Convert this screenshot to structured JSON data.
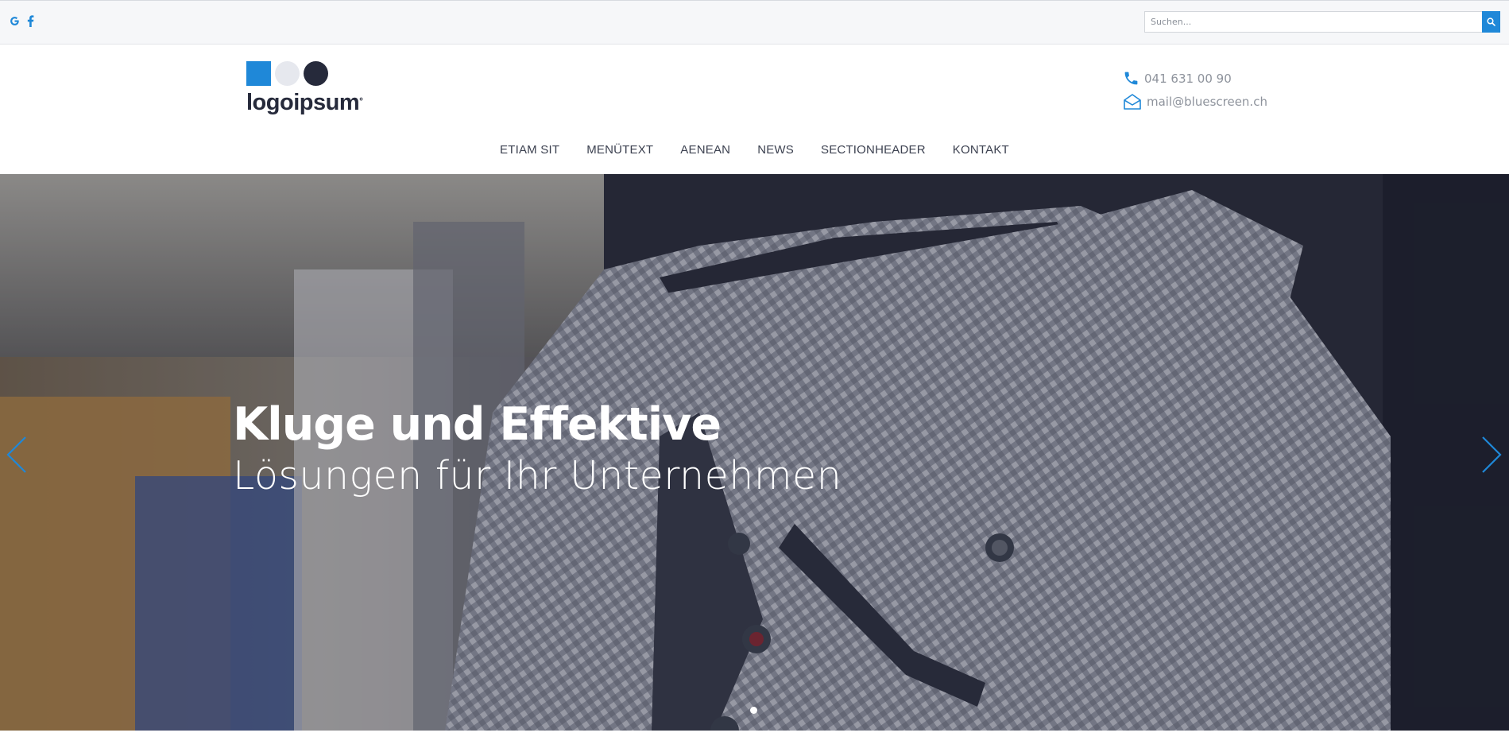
{
  "topbar": {
    "social": [
      {
        "name": "google-icon",
        "label": "Google"
      },
      {
        "name": "facebook-icon",
        "label": "Facebook"
      }
    ],
    "search": {
      "placeholder": "Suchen...",
      "value": ""
    }
  },
  "header": {
    "logo_text": "logoipsum",
    "logo_mark": "°",
    "phone": "041 631 00 90",
    "email": "mail@bluescreen.ch"
  },
  "nav": {
    "items": [
      "ETIAM SIT",
      "MENÜTEXT",
      "AENEAN",
      "NEWS",
      "SECTIONHEADER",
      "KONTAKT"
    ]
  },
  "hero": {
    "title": "Kluge und Effektive",
    "subtitle": "Lösungen für Ihr Unternehmen",
    "slide_count": 1,
    "active_slide": 1
  },
  "colors": {
    "accent": "#1f88d8",
    "dark": "#262a3b",
    "topbar_bg": "#f6f7f9",
    "nav_text": "#3c4150",
    "contact_text": "#8e939c"
  }
}
